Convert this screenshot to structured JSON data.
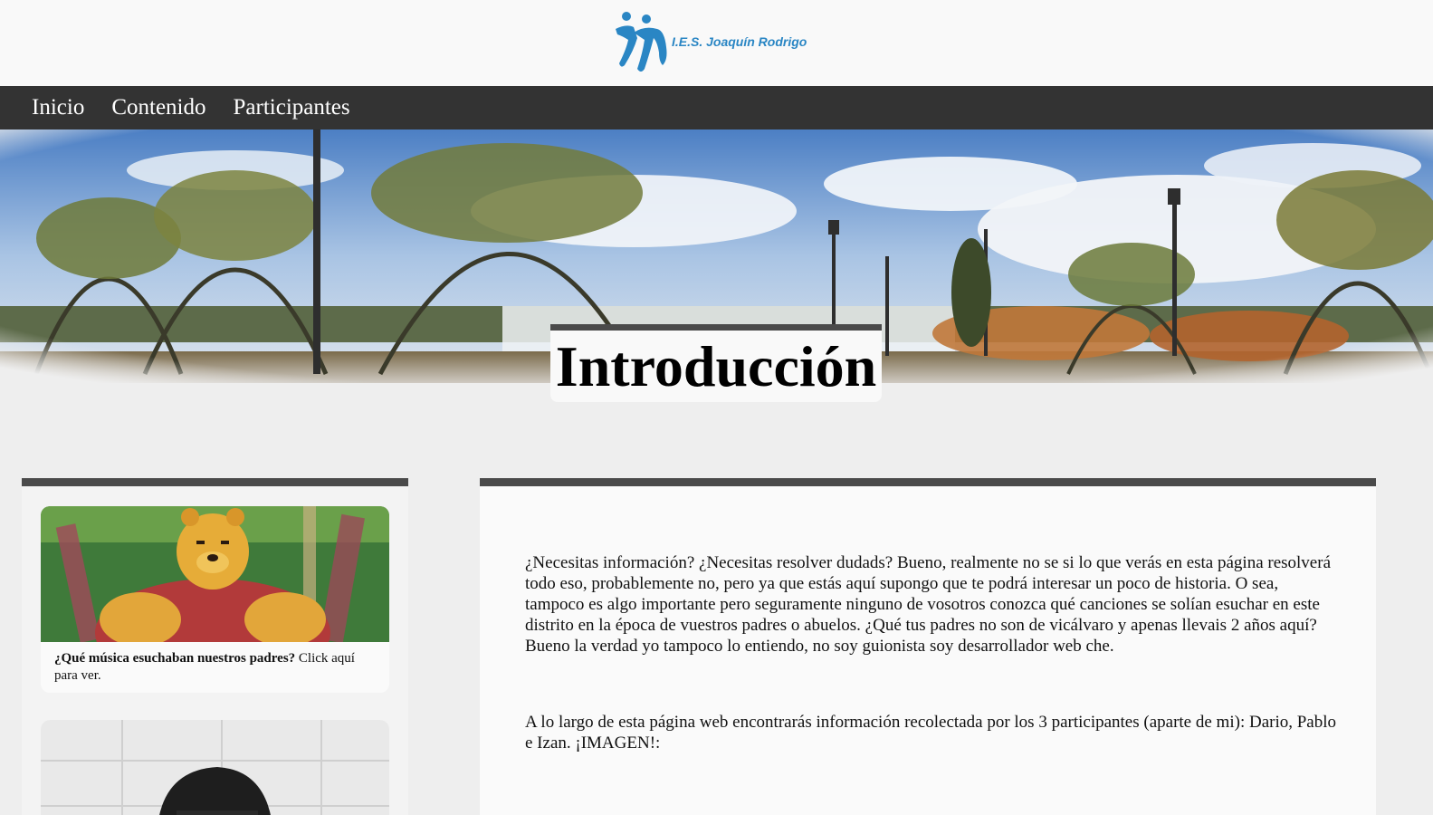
{
  "header": {
    "logo_text": "I.E.S. Joaquín Rodrigo",
    "logo_color": "#2a86c4"
  },
  "nav": {
    "items": [
      {
        "label": "Inicio"
      },
      {
        "label": "Contenido"
      },
      {
        "label": "Participantes"
      }
    ],
    "background": "#333333"
  },
  "hero": {
    "title": "Introducción"
  },
  "sidebar": {
    "cards": [
      {
        "bold": "¿Qué música esuchaban nuestros padres?",
        "text": " Click aquí para ver."
      },
      {
        "bold": "",
        "text": ""
      }
    ]
  },
  "main": {
    "paragraphs": [
      "¿Necesitas información? ¿Necesitas resolver dudads? Bueno, realmente no se si lo que verás en esta página resolverá todo eso, probablemente no, pero ya que estás aquí supongo que te podrá interesar un poco de historia. O sea, tampoco es algo importante pero seguramente ninguno de vosotros conozca qué canciones se solían esuchar en este distrito en la época de vuestros padres o abuelos. ¿Qué tus padres no son de vicálvaro y apenas llevais 2 años aquí? Bueno la verdad yo tampoco lo entiendo, no soy guionista soy desarrollador web che.",
      "A lo largo de esta página web encontrarás información recolectada por los 3 participantes (aparte de mi): Dario, Pablo e Izan. ¡IMAGEN!:"
    ]
  }
}
